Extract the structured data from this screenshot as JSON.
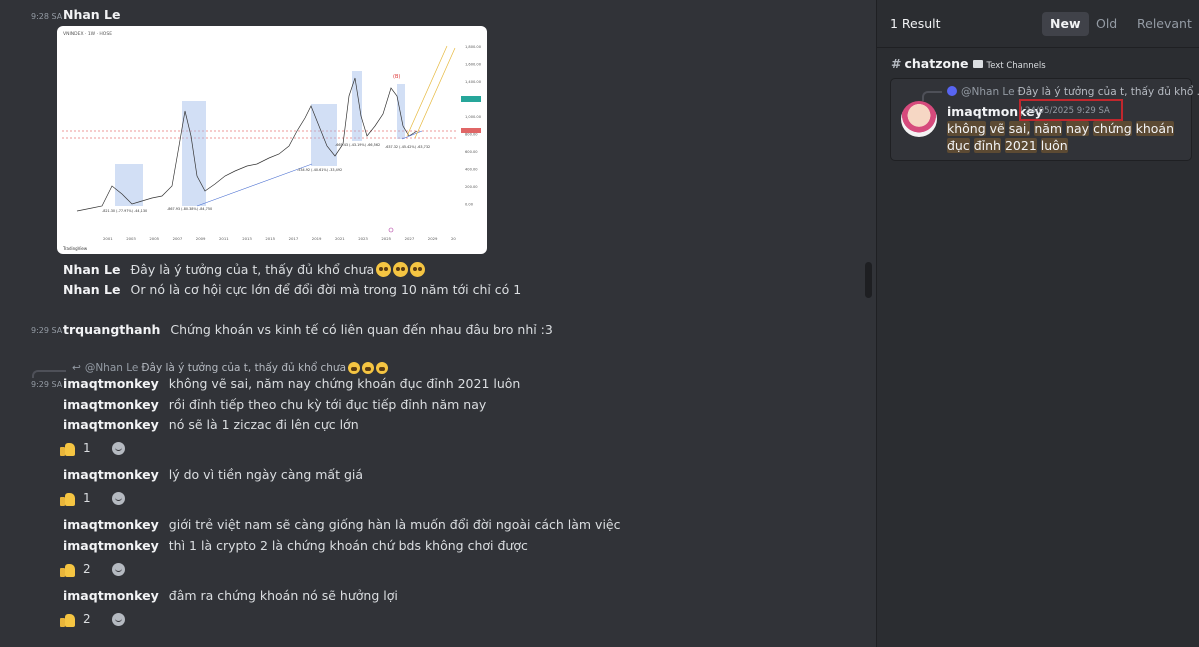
{
  "chat": {
    "header_time": "9:28 SA",
    "header_author": "Nhan Le",
    "messages": [
      {
        "author": "Nhan Le",
        "text": "Đây là ý tưởng của t, thấy đủ khổ chưa"
      },
      {
        "author": "Nhan Le",
        "text": "Or nó là cơ hội cực lớn để đổi đời mà trong 10 năm tới chỉ có 1"
      }
    ],
    "trq": {
      "time": "9:29 SA",
      "author": "trquangthanh",
      "text": "Chứng khoán vs kinh tế có liên quan đến nhau đâu bro nhỉ :3"
    },
    "reply_preview": {
      "name": "@Nhan Le",
      "text": "Đây là ý tưởng của t, thấy đủ khổ chưa"
    },
    "imaq": {
      "time": "9:29 SA",
      "author": "imaqtmonkey",
      "lines": [
        "không vẽ sai, năm nay chứng khoán đục đỉnh 2021 luôn",
        "rồi đỉnh tiếp theo chu kỳ tới đục tiếp đỉnh năm nay",
        "nó sẽ là 1 ziczac đi lên cực lớn",
        "lý do vì tiền ngày càng mất giá",
        "giới trẻ việt nam sẽ càng giống hàn là muốn đổi đời ngoài cách làm việc",
        "thì 1 là crypto 2 là chứng khoán chứ bds không chơi được",
        "đâm ra chứng khoán nó sẽ hưởng lợi"
      ]
    },
    "reactions": [
      "1",
      "1",
      "2",
      "2"
    ],
    "chart_embed": {
      "header": "VNINDEX · 1W · HOSE",
      "price_labels": [
        "1,800.00",
        "1,600.00",
        "1,400.00",
        "1,200.00",
        "1,000.00",
        "800.00",
        "600.00",
        "400.00",
        "200.00",
        "0.00"
      ],
      "year_labels": [
        "2001",
        "2003",
        "2005",
        "2007",
        "2009",
        "2011",
        "2013",
        "2015",
        "2017",
        "2019",
        "2021",
        "2023",
        "2025",
        "2027",
        "2029",
        "20"
      ],
      "measure_labels": [
        "-821.30 (-77.97%) -44,130",
        "-867.93 (-80.38%) -84,750",
        "-534.92 (-40.61%) -33,492",
        "-665.43 (-43.19%) -66,562",
        "-637.32 (-45.42%) -63,732"
      ],
      "marker": "(B)",
      "footer": "TradingView"
    }
  },
  "search": {
    "result_count": "1 Result",
    "sort_options": [
      "New",
      "Old",
      "Relevant"
    ],
    "channel": "chatzone",
    "category": "Text Channels",
    "card": {
      "reply_name": "@Nhan Le",
      "reply_text": "Đây là ý tưởng của t, thấy đủ khổ ...",
      "author": "imaqtmonkey",
      "timestamp": "24/05/2025 9:29 SA",
      "words": [
        "không",
        "vẽ",
        "sai,",
        "năm",
        "nay",
        "chứng",
        "khoán",
        "đục",
        "đỉnh",
        "2021",
        "luôn"
      ]
    }
  }
}
